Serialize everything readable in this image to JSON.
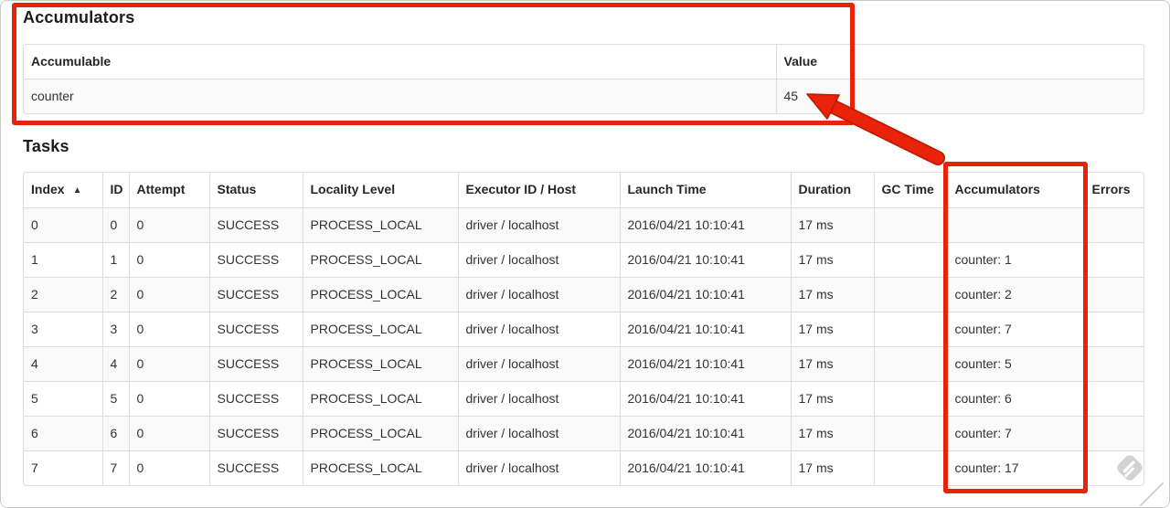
{
  "annotation": {
    "highlight_color": "#e8230a",
    "highlight_outline_color": "#bf1a03"
  },
  "accumulators_section": {
    "heading": "Accumulators",
    "columns": {
      "accumulable": "Accumulable",
      "value": "Value"
    },
    "rows": [
      {
        "accumulable": "counter",
        "value": "45"
      }
    ]
  },
  "tasks_section": {
    "heading": "Tasks",
    "sort_indicator": "▲",
    "columns": {
      "index": "Index",
      "id": "ID",
      "attempt": "Attempt",
      "status": "Status",
      "locality": "Locality Level",
      "executor": "Executor ID / Host",
      "launch_time": "Launch Time",
      "duration": "Duration",
      "gc_time": "GC Time",
      "accumulators": "Accumulators",
      "errors": "Errors"
    },
    "rows": [
      {
        "index": "0",
        "id": "0",
        "attempt": "0",
        "status": "SUCCESS",
        "locality": "PROCESS_LOCAL",
        "executor": "driver / localhost",
        "launch_time": "2016/04/21 10:10:41",
        "duration": "17 ms",
        "gc_time": "",
        "accumulators": "",
        "errors": ""
      },
      {
        "index": "1",
        "id": "1",
        "attempt": "0",
        "status": "SUCCESS",
        "locality": "PROCESS_LOCAL",
        "executor": "driver / localhost",
        "launch_time": "2016/04/21 10:10:41",
        "duration": "17 ms",
        "gc_time": "",
        "accumulators": "counter: 1",
        "errors": ""
      },
      {
        "index": "2",
        "id": "2",
        "attempt": "0",
        "status": "SUCCESS",
        "locality": "PROCESS_LOCAL",
        "executor": "driver / localhost",
        "launch_time": "2016/04/21 10:10:41",
        "duration": "17 ms",
        "gc_time": "",
        "accumulators": "counter: 2",
        "errors": ""
      },
      {
        "index": "3",
        "id": "3",
        "attempt": "0",
        "status": "SUCCESS",
        "locality": "PROCESS_LOCAL",
        "executor": "driver / localhost",
        "launch_time": "2016/04/21 10:10:41",
        "duration": "17 ms",
        "gc_time": "",
        "accumulators": "counter: 7",
        "errors": ""
      },
      {
        "index": "4",
        "id": "4",
        "attempt": "0",
        "status": "SUCCESS",
        "locality": "PROCESS_LOCAL",
        "executor": "driver / localhost",
        "launch_time": "2016/04/21 10:10:41",
        "duration": "17 ms",
        "gc_time": "",
        "accumulators": "counter: 5",
        "errors": ""
      },
      {
        "index": "5",
        "id": "5",
        "attempt": "0",
        "status": "SUCCESS",
        "locality": "PROCESS_LOCAL",
        "executor": "driver / localhost",
        "launch_time": "2016/04/21 10:10:41",
        "duration": "17 ms",
        "gc_time": "",
        "accumulators": "counter: 6",
        "errors": ""
      },
      {
        "index": "6",
        "id": "6",
        "attempt": "0",
        "status": "SUCCESS",
        "locality": "PROCESS_LOCAL",
        "executor": "driver / localhost",
        "launch_time": "2016/04/21 10:10:41",
        "duration": "17 ms",
        "gc_time": "",
        "accumulators": "counter: 7",
        "errors": ""
      },
      {
        "index": "7",
        "id": "7",
        "attempt": "0",
        "status": "SUCCESS",
        "locality": "PROCESS_LOCAL",
        "executor": "driver / localhost",
        "launch_time": "2016/04/21 10:10:41",
        "duration": "17 ms",
        "gc_time": "",
        "accumulators": "counter: 17",
        "errors": ""
      }
    ]
  }
}
